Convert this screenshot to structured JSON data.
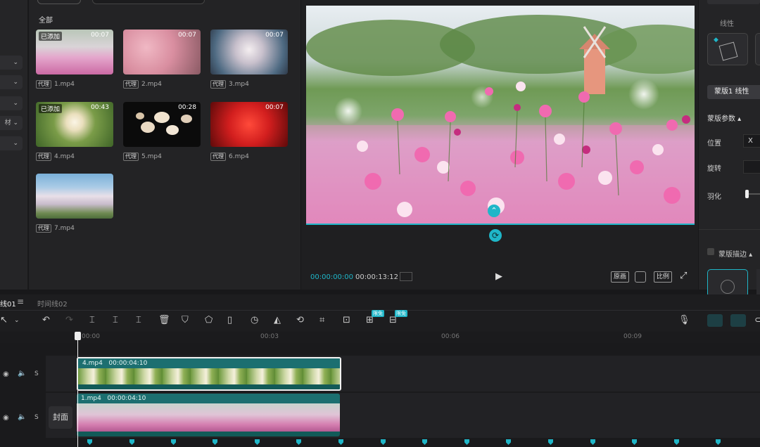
{
  "media": {
    "category": "全部",
    "items": [
      {
        "name": "1.mp4",
        "duration": "00:07",
        "added": "已添加",
        "proxy": "代理"
      },
      {
        "name": "2.mp4",
        "duration": "00:07",
        "added": "",
        "proxy": "代理"
      },
      {
        "name": "3.mp4",
        "duration": "00:07",
        "added": "",
        "proxy": "代理"
      },
      {
        "name": "4.mp4",
        "duration": "00:43",
        "added": "已添加",
        "proxy": "代理"
      },
      {
        "name": "5.mp4",
        "duration": "00:28",
        "added": "",
        "proxy": "代理"
      },
      {
        "name": "6.mp4",
        "duration": "00:07",
        "added": "",
        "proxy": "代理"
      },
      {
        "name": "7.mp4",
        "duration": "",
        "added": "",
        "proxy": "代理"
      }
    ],
    "filter_strip_partial": [
      "材"
    ]
  },
  "preview": {
    "current_time": "00:00:00:00",
    "total_time": "00:00:13:12",
    "btn_original": "原画",
    "btn_ratio": "比例"
  },
  "inspector": {
    "linear_label": "线性",
    "mask_selected": "蒙版1 线性",
    "params_label": "蒙版参数",
    "position_label": "位置",
    "position_x": "X",
    "rotation_label": "旋转",
    "feather_label": "羽化",
    "stroke_label": "蒙版描边"
  },
  "timeline": {
    "tab_active": "线01",
    "tab_other": "时间线02",
    "free_label": "限免",
    "ruler": [
      "00:00",
      "00:03",
      "00:06",
      "00:09"
    ],
    "cover_label": "封面",
    "solo_label": "S",
    "clips": [
      {
        "name": "4.mp4",
        "duration": "00:00:04:10"
      },
      {
        "name": "1.mp4",
        "duration": "00:00:04:10"
      }
    ]
  },
  "colors": {
    "accent": "#1fb6c8",
    "clip": "#125a58"
  }
}
